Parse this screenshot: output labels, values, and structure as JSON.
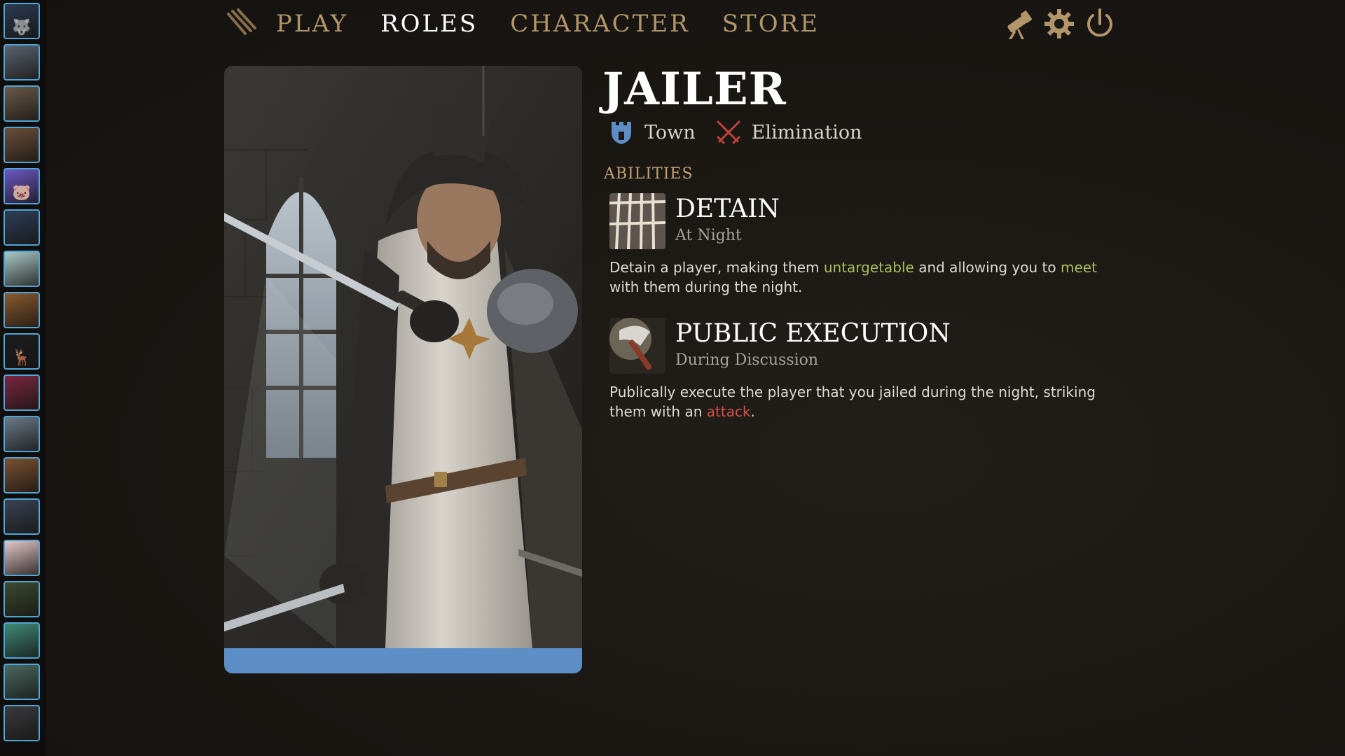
{
  "nav": {
    "items": [
      {
        "label": "PLAY",
        "active": false
      },
      {
        "label": "ROLES",
        "active": true
      },
      {
        "label": "CHARACTER",
        "active": false
      },
      {
        "label": "STORE",
        "active": false
      }
    ],
    "tools": [
      "telescope-icon",
      "gear-icon",
      "power-icon"
    ],
    "colors": {
      "inactive": "#b3956a",
      "active": "#ffffff"
    }
  },
  "sidebar": {
    "items": [
      {
        "icon": "wolf-icon",
        "color": "#2b3a52"
      },
      {
        "icon": "priest-icon",
        "color": "#5b6470"
      },
      {
        "icon": "crocodile-icon",
        "color": "#6a5a48"
      },
      {
        "icon": "warrior-icon",
        "color": "#6b4e3a"
      },
      {
        "icon": "pig-icon",
        "color": "#6c58c4"
      },
      {
        "icon": "anime-boy-icon",
        "color": "#2d3e58"
      },
      {
        "icon": "spirit-icon",
        "color": "#a8c8c8"
      },
      {
        "icon": "orange-mask-icon",
        "color": "#8a5a2e"
      },
      {
        "icon": "deer-icon",
        "color": "#1d1d1f"
      },
      {
        "icon": "demon-icon",
        "color": "#7a2740"
      },
      {
        "icon": "hacker-icon",
        "color": "#6a7a88"
      },
      {
        "icon": "witch-icon",
        "color": "#7a5030"
      },
      {
        "icon": "shadow-icon",
        "color": "#3a4252"
      },
      {
        "icon": "cat-girl-icon",
        "color": "#e4c6c8"
      },
      {
        "icon": "soldier-icon",
        "color": "#3c4a30"
      },
      {
        "icon": "mermaid-icon",
        "color": "#3f8a78"
      },
      {
        "icon": "dancer-icon",
        "color": "#4a6a60"
      },
      {
        "icon": "bandit-icon",
        "color": "#3a3a3e"
      }
    ],
    "border_color": "#4fa6d8"
  },
  "role": {
    "name": "JAILER",
    "faction": "Town",
    "faction_icon": "castle-shield-icon",
    "faction_color": "#5e8ec6",
    "category": "Elimination",
    "category_icon": "crossed-swords-icon",
    "category_color": "#c0423c",
    "art": "jailer-portrait-image"
  },
  "abilities": {
    "heading": "ABILITIES",
    "list": [
      {
        "name": "DETAIN",
        "timing": "At Night",
        "icon": "jail-bars-icon",
        "desc": [
          {
            "text": "Detain a player, making them ",
            "kw": ""
          },
          {
            "text": "untargetable",
            "kw": "green"
          },
          {
            "text": " and allowing you to ",
            "kw": ""
          },
          {
            "text": "meet",
            "kw": "green"
          },
          {
            "text": " with them during the night.",
            "kw": ""
          }
        ]
      },
      {
        "name": "PUBLIC EXECUTION",
        "timing": "During Discussion",
        "icon": "executioner-axe-icon",
        "desc": [
          {
            "text": "Publically execute the player that you jailed during the night, striking them with an ",
            "kw": ""
          },
          {
            "text": "attack",
            "kw": "red"
          },
          {
            "text": ".",
            "kw": ""
          }
        ]
      }
    ]
  }
}
